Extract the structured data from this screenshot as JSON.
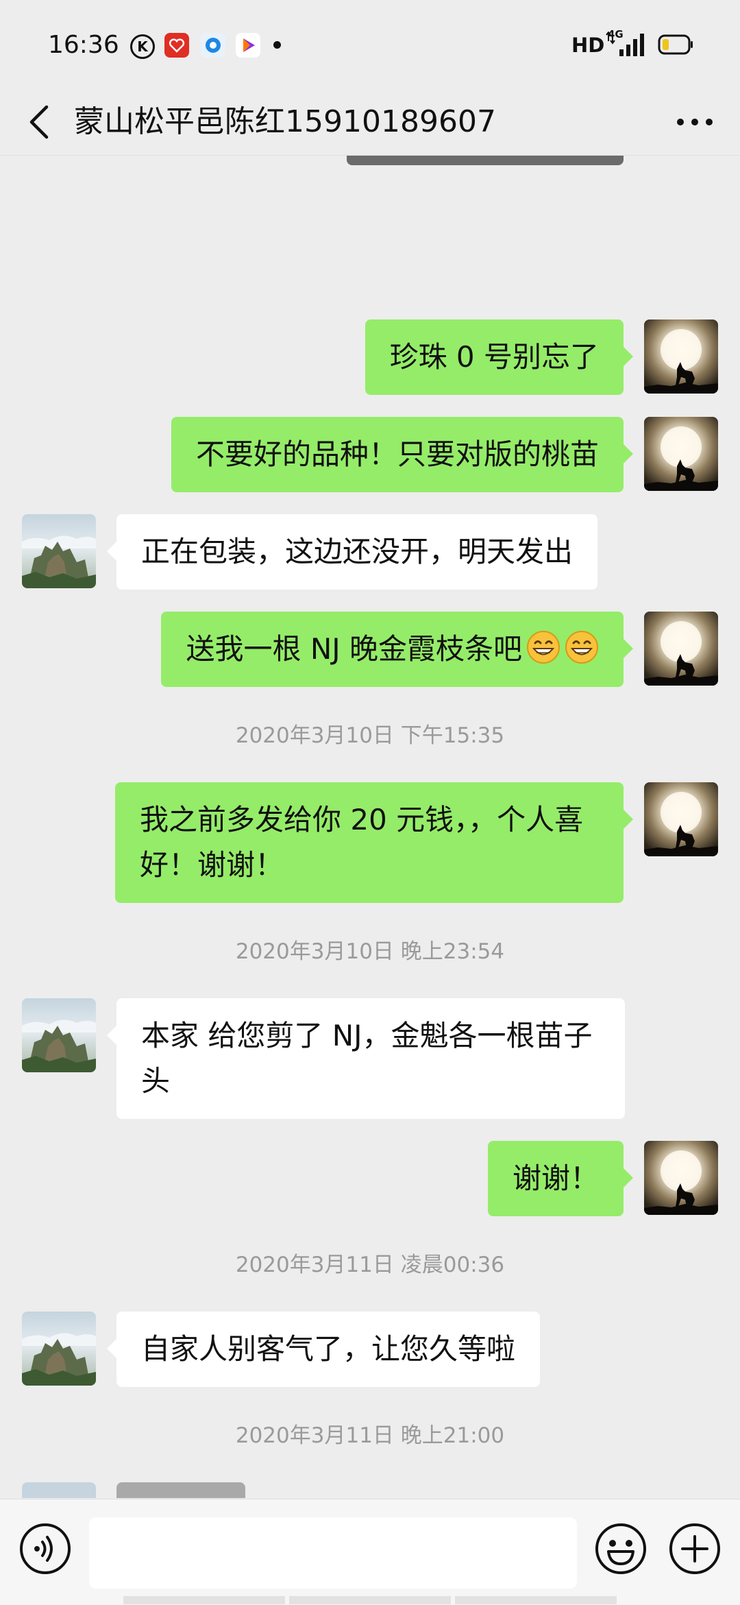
{
  "status_bar": {
    "time": "16:36",
    "app_icons": [
      "k-app-icon",
      "pinduoduo-app-icon",
      "circle-app-icon",
      "video-app-icon"
    ],
    "hd_label": "HD",
    "network_label": "4G",
    "battery_icon": "battery-low-icon"
  },
  "header": {
    "title": "蒙山松平邑陈红15910189607",
    "back_icon": "chevron-left-icon",
    "more_icon": "more-dots-icon"
  },
  "messages": [
    {
      "type": "text",
      "sender": "self",
      "text": "珍珠 0 号别忘了"
    },
    {
      "type": "text",
      "sender": "self",
      "text": "不要好的品种！只要对版的桃苗"
    },
    {
      "type": "text",
      "sender": "peer",
      "text": "正在包装，这边还没开，明天发出"
    },
    {
      "type": "text",
      "sender": "self",
      "text": "送我一根 NJ 晚金霞枝条吧",
      "emojis": [
        "grin-emoji",
        "grin-emoji"
      ]
    },
    {
      "type": "timestamp",
      "text": "2020年3月10日 下午15:35"
    },
    {
      "type": "text",
      "sender": "self",
      "text": "我之前多发给你 20 元钱，，个人喜好！谢谢！"
    },
    {
      "type": "timestamp",
      "text": "2020年3月10日 晚上23:54"
    },
    {
      "type": "text",
      "sender": "peer",
      "text": "本家 给您剪了 NJ，金魁各一根苗子头"
    },
    {
      "type": "text",
      "sender": "self",
      "text": "谢谢！"
    },
    {
      "type": "timestamp",
      "text": "2020年3月11日 凌晨00:36"
    },
    {
      "type": "text",
      "sender": "peer",
      "text": "自家人别客气了，让您久等啦"
    },
    {
      "type": "timestamp",
      "text": "2020年3月11日 晚上21:00"
    }
  ],
  "input_bar": {
    "voice_icon": "voice-icon",
    "input_value": "",
    "emoji_icon": "emoji-smile-icon",
    "plus_icon": "plus-circle-icon"
  },
  "colors": {
    "background": "#ededed",
    "self_bubble": "#95ec69",
    "peer_bubble": "#ffffff",
    "timestamp_text": "#9a9a9a"
  }
}
